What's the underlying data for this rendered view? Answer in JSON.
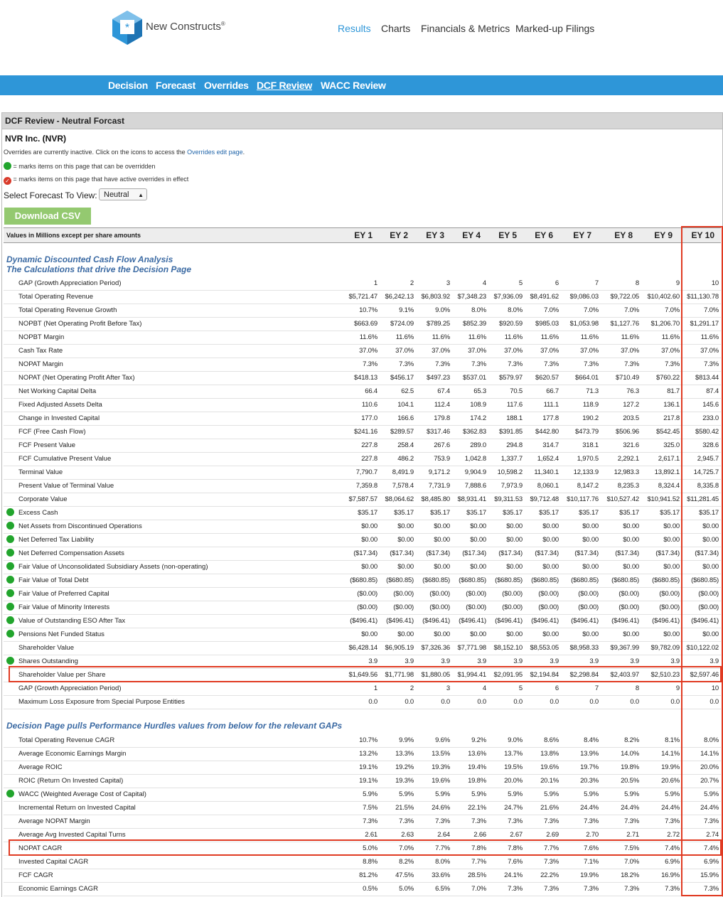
{
  "brand": {
    "name": "New Constructs",
    "mark": "®"
  },
  "top_nav": [
    "Results",
    "Charts",
    "Financials & Metrics",
    "Marked-up Filings"
  ],
  "sub_nav": [
    "Decision",
    "Forecast",
    "Overrides",
    "DCF Review",
    "WACC Review"
  ],
  "panel": {
    "title": "DCF Review - Neutral Forcast",
    "company": "NVR Inc. (NVR)",
    "overrides_text": "Overrides are currently inactive. Click on the icons to access the ",
    "overrides_link": "Overrides edit page",
    "overrides_end": ".",
    "legend_green": "= marks items on this page that can be overridden",
    "legend_red": "= marks items on this page that have active overrides in effect",
    "select_label": "Select Forecast To View:",
    "select_value": "Neutral",
    "download_label": "Download CSV"
  },
  "table": {
    "header_label": "Values in Millions except per share amounts",
    "columns": [
      "EY 1",
      "EY 2",
      "EY 3",
      "EY 4",
      "EY 5",
      "EY 6",
      "EY 7",
      "EY 8",
      "EY 9",
      "EY 10"
    ],
    "section1_title": "Dynamic Discounted Cash Flow Analysis",
    "section1_subtitle": "The Calculations that drive the Decision Page",
    "section2_title": "Decision Page pulls Performance Hurdles values from below for the relevant GAPs",
    "rows1": [
      {
        "label": "GAP (Growth Appreciation Period)",
        "dot": false,
        "values": [
          "1",
          "2",
          "3",
          "4",
          "5",
          "6",
          "7",
          "8",
          "9",
          "10"
        ]
      },
      {
        "label": "Total Operating Revenue",
        "dot": false,
        "values": [
          "$5,721.47",
          "$6,242.13",
          "$6,803.92",
          "$7,348.23",
          "$7,936.09",
          "$8,491.62",
          "$9,086.03",
          "$9,722.05",
          "$10,402.60",
          "$11,130.78"
        ]
      },
      {
        "label": "Total Operating Revenue Growth",
        "dot": false,
        "values": [
          "10.7%",
          "9.1%",
          "9.0%",
          "8.0%",
          "8.0%",
          "7.0%",
          "7.0%",
          "7.0%",
          "7.0%",
          "7.0%"
        ]
      },
      {
        "label": "NOPBT (Net Operating Profit Before Tax)",
        "dot": false,
        "values": [
          "$663.69",
          "$724.09",
          "$789.25",
          "$852.39",
          "$920.59",
          "$985.03",
          "$1,053.98",
          "$1,127.76",
          "$1,206.70",
          "$1,291.17"
        ]
      },
      {
        "label": "NOPBT Margin",
        "dot": false,
        "values": [
          "11.6%",
          "11.6%",
          "11.6%",
          "11.6%",
          "11.6%",
          "11.6%",
          "11.6%",
          "11.6%",
          "11.6%",
          "11.6%"
        ]
      },
      {
        "label": "Cash Tax Rate",
        "dot": false,
        "values": [
          "37.0%",
          "37.0%",
          "37.0%",
          "37.0%",
          "37.0%",
          "37.0%",
          "37.0%",
          "37.0%",
          "37.0%",
          "37.0%"
        ]
      },
      {
        "label": "NOPAT Margin",
        "dot": false,
        "values": [
          "7.3%",
          "7.3%",
          "7.3%",
          "7.3%",
          "7.3%",
          "7.3%",
          "7.3%",
          "7.3%",
          "7.3%",
          "7.3%"
        ]
      },
      {
        "label": "NOPAT (Net Operating Profit After Tax)",
        "dot": false,
        "values": [
          "$418.13",
          "$456.17",
          "$497.23",
          "$537.01",
          "$579.97",
          "$620.57",
          "$664.01",
          "$710.49",
          "$760.22",
          "$813.44"
        ]
      },
      {
        "label": "Net Working Capital Delta",
        "dot": false,
        "values": [
          "66.4",
          "62.5",
          "67.4",
          "65.3",
          "70.5",
          "66.7",
          "71.3",
          "76.3",
          "81.7",
          "87.4"
        ]
      },
      {
        "label": "Fixed Adjusted Assets Delta",
        "dot": false,
        "values": [
          "110.6",
          "104.1",
          "112.4",
          "108.9",
          "117.6",
          "111.1",
          "118.9",
          "127.2",
          "136.1",
          "145.6"
        ]
      },
      {
        "label": "Change in Invested Capital",
        "dot": false,
        "values": [
          "177.0",
          "166.6",
          "179.8",
          "174.2",
          "188.1",
          "177.8",
          "190.2",
          "203.5",
          "217.8",
          "233.0"
        ]
      },
      {
        "label": "FCF (Free Cash Flow)",
        "dot": false,
        "values": [
          "$241.16",
          "$289.57",
          "$317.46",
          "$362.83",
          "$391.85",
          "$442.80",
          "$473.79",
          "$506.96",
          "$542.45",
          "$580.42"
        ]
      },
      {
        "label": "FCF Present Value",
        "dot": false,
        "values": [
          "227.8",
          "258.4",
          "267.6",
          "289.0",
          "294.8",
          "314.7",
          "318.1",
          "321.6",
          "325.0",
          "328.6"
        ]
      },
      {
        "label": "FCF Cumulative Present Value",
        "dot": false,
        "values": [
          "227.8",
          "486.2",
          "753.9",
          "1,042.8",
          "1,337.7",
          "1,652.4",
          "1,970.5",
          "2,292.1",
          "2,617.1",
          "2,945.7"
        ]
      },
      {
        "label": "Terminal Value",
        "dot": false,
        "values": [
          "7,790.7",
          "8,491.9",
          "9,171.2",
          "9,904.9",
          "10,598.2",
          "11,340.1",
          "12,133.9",
          "12,983.3",
          "13,892.1",
          "14,725.7"
        ]
      },
      {
        "label": "Present Value of Terminal Value",
        "dot": false,
        "values": [
          "7,359.8",
          "7,578.4",
          "7,731.9",
          "7,888.6",
          "7,973.9",
          "8,060.1",
          "8,147.2",
          "8,235.3",
          "8,324.4",
          "8,335.8"
        ]
      },
      {
        "label": "Corporate Value",
        "dot": false,
        "values": [
          "$7,587.57",
          "$8,064.62",
          "$8,485.80",
          "$8,931.41",
          "$9,311.53",
          "$9,712.48",
          "$10,117.76",
          "$10,527.42",
          "$10,941.52",
          "$11,281.45"
        ]
      },
      {
        "label": "Excess Cash",
        "dot": true,
        "values": [
          "$35.17",
          "$35.17",
          "$35.17",
          "$35.17",
          "$35.17",
          "$35.17",
          "$35.17",
          "$35.17",
          "$35.17",
          "$35.17"
        ]
      },
      {
        "label": "Net Assets from Discontinued Operations",
        "dot": true,
        "values": [
          "$0.00",
          "$0.00",
          "$0.00",
          "$0.00",
          "$0.00",
          "$0.00",
          "$0.00",
          "$0.00",
          "$0.00",
          "$0.00"
        ]
      },
      {
        "label": "Net Deferred Tax Liability",
        "dot": true,
        "values": [
          "$0.00",
          "$0.00",
          "$0.00",
          "$0.00",
          "$0.00",
          "$0.00",
          "$0.00",
          "$0.00",
          "$0.00",
          "$0.00"
        ]
      },
      {
        "label": "Net Deferred Compensation Assets",
        "dot": true,
        "values": [
          "($17.34)",
          "($17.34)",
          "($17.34)",
          "($17.34)",
          "($17.34)",
          "($17.34)",
          "($17.34)",
          "($17.34)",
          "($17.34)",
          "($17.34)"
        ]
      },
      {
        "label": "Fair Value of Unconsolidated Subsidiary Assets (non-operating)",
        "dot": true,
        "values": [
          "$0.00",
          "$0.00",
          "$0.00",
          "$0.00",
          "$0.00",
          "$0.00",
          "$0.00",
          "$0.00",
          "$0.00",
          "$0.00"
        ]
      },
      {
        "label": "Fair Value of Total Debt",
        "dot": true,
        "values": [
          "($680.85)",
          "($680.85)",
          "($680.85)",
          "($680.85)",
          "($680.85)",
          "($680.85)",
          "($680.85)",
          "($680.85)",
          "($680.85)",
          "($680.85)"
        ]
      },
      {
        "label": "Fair Value of Preferred Capital",
        "dot": true,
        "values": [
          "($0.00)",
          "($0.00)",
          "($0.00)",
          "($0.00)",
          "($0.00)",
          "($0.00)",
          "($0.00)",
          "($0.00)",
          "($0.00)",
          "($0.00)"
        ]
      },
      {
        "label": "Fair Value of Minority Interests",
        "dot": true,
        "values": [
          "($0.00)",
          "($0.00)",
          "($0.00)",
          "($0.00)",
          "($0.00)",
          "($0.00)",
          "($0.00)",
          "($0.00)",
          "($0.00)",
          "($0.00)"
        ]
      },
      {
        "label": "Value of Outstanding ESO After Tax",
        "dot": true,
        "values": [
          "($496.41)",
          "($496.41)",
          "($496.41)",
          "($496.41)",
          "($496.41)",
          "($496.41)",
          "($496.41)",
          "($496.41)",
          "($496.41)",
          "($496.41)"
        ]
      },
      {
        "label": "Pensions Net Funded Status",
        "dot": true,
        "values": [
          "$0.00",
          "$0.00",
          "$0.00",
          "$0.00",
          "$0.00",
          "$0.00",
          "$0.00",
          "$0.00",
          "$0.00",
          "$0.00"
        ]
      },
      {
        "label": "Shareholder Value",
        "dot": false,
        "values": [
          "$6,428.14",
          "$6,905.19",
          "$7,326.36",
          "$7,771.98",
          "$8,152.10",
          "$8,553.05",
          "$8,958.33",
          "$9,367.99",
          "$9,782.09",
          "$10,122.02"
        ]
      },
      {
        "label": "Shares Outstanding",
        "dot": true,
        "values": [
          "3.9",
          "3.9",
          "3.9",
          "3.9",
          "3.9",
          "3.9",
          "3.9",
          "3.9",
          "3.9",
          "3.9"
        ]
      },
      {
        "label": "Shareholder Value per Share",
        "dot": false,
        "values": [
          "$1,649.56",
          "$1,771.98",
          "$1,880.05",
          "$1,994.41",
          "$2,091.95",
          "$2,194.84",
          "$2,298.84",
          "$2,403.97",
          "$2,510.23",
          "$2,597.46"
        ]
      },
      {
        "label": "GAP (Growth Appreciation Period)",
        "dot": false,
        "values": [
          "1",
          "2",
          "3",
          "4",
          "5",
          "6",
          "7",
          "8",
          "9",
          "10"
        ]
      },
      {
        "label": "Maximum Loss Exposure from Special Purpose Entities",
        "dot": false,
        "values": [
          "0.0",
          "0.0",
          "0.0",
          "0.0",
          "0.0",
          "0.0",
          "0.0",
          "0.0",
          "0.0",
          "0.0"
        ]
      }
    ],
    "rows2": [
      {
        "label": "Total Operating Revenue CAGR",
        "dot": false,
        "values": [
          "10.7%",
          "9.9%",
          "9.6%",
          "9.2%",
          "9.0%",
          "8.6%",
          "8.4%",
          "8.2%",
          "8.1%",
          "8.0%"
        ]
      },
      {
        "label": "Average Economic Earnings Margin",
        "dot": false,
        "values": [
          "13.2%",
          "13.3%",
          "13.5%",
          "13.6%",
          "13.7%",
          "13.8%",
          "13.9%",
          "14.0%",
          "14.1%",
          "14.1%"
        ]
      },
      {
        "label": "Average ROIC",
        "dot": false,
        "values": [
          "19.1%",
          "19.2%",
          "19.3%",
          "19.4%",
          "19.5%",
          "19.6%",
          "19.7%",
          "19.8%",
          "19.9%",
          "20.0%"
        ]
      },
      {
        "label": "ROIC (Return On Invested Capital)",
        "dot": false,
        "values": [
          "19.1%",
          "19.3%",
          "19.6%",
          "19.8%",
          "20.0%",
          "20.1%",
          "20.3%",
          "20.5%",
          "20.6%",
          "20.7%"
        ]
      },
      {
        "label": "WACC (Weighted Average Cost of Capital)",
        "dot": true,
        "values": [
          "5.9%",
          "5.9%",
          "5.9%",
          "5.9%",
          "5.9%",
          "5.9%",
          "5.9%",
          "5.9%",
          "5.9%",
          "5.9%"
        ]
      },
      {
        "label": "Incremental Return on Invested Capital",
        "dot": false,
        "values": [
          "7.5%",
          "21.5%",
          "24.6%",
          "22.1%",
          "24.7%",
          "21.6%",
          "24.4%",
          "24.4%",
          "24.4%",
          "24.4%"
        ]
      },
      {
        "label": "Average NOPAT Margin",
        "dot": false,
        "values": [
          "7.3%",
          "7.3%",
          "7.3%",
          "7.3%",
          "7.3%",
          "7.3%",
          "7.3%",
          "7.3%",
          "7.3%",
          "7.3%"
        ]
      },
      {
        "label": "Average Avg Invested Capital Turns",
        "dot": false,
        "values": [
          "2.61",
          "2.63",
          "2.64",
          "2.66",
          "2.67",
          "2.69",
          "2.70",
          "2.71",
          "2.72",
          "2.74"
        ]
      },
      {
        "label": "NOPAT CAGR",
        "dot": false,
        "values": [
          "5.0%",
          "7.0%",
          "7.7%",
          "7.8%",
          "7.8%",
          "7.7%",
          "7.6%",
          "7.5%",
          "7.4%",
          "7.4%"
        ]
      },
      {
        "label": "Invested Capital CAGR",
        "dot": false,
        "values": [
          "8.8%",
          "8.2%",
          "8.0%",
          "7.7%",
          "7.6%",
          "7.3%",
          "7.1%",
          "7.0%",
          "6.9%",
          "6.9%"
        ]
      },
      {
        "label": "FCF CAGR",
        "dot": false,
        "values": [
          "81.2%",
          "47.5%",
          "33.6%",
          "28.5%",
          "24.1%",
          "22.2%",
          "19.9%",
          "18.2%",
          "16.9%",
          "15.9%"
        ]
      },
      {
        "label": "Economic Earnings CAGR",
        "dot": false,
        "values": [
          "0.5%",
          "5.0%",
          "6.5%",
          "7.0%",
          "7.3%",
          "7.3%",
          "7.3%",
          "7.3%",
          "7.3%",
          "7.3%"
        ]
      }
    ]
  },
  "colors": {
    "accent": "#2e96d8",
    "highlight": "#e03a22",
    "override_dot": "#22a52d",
    "download": "#94c970",
    "section_title": "#3b6aa3"
  }
}
